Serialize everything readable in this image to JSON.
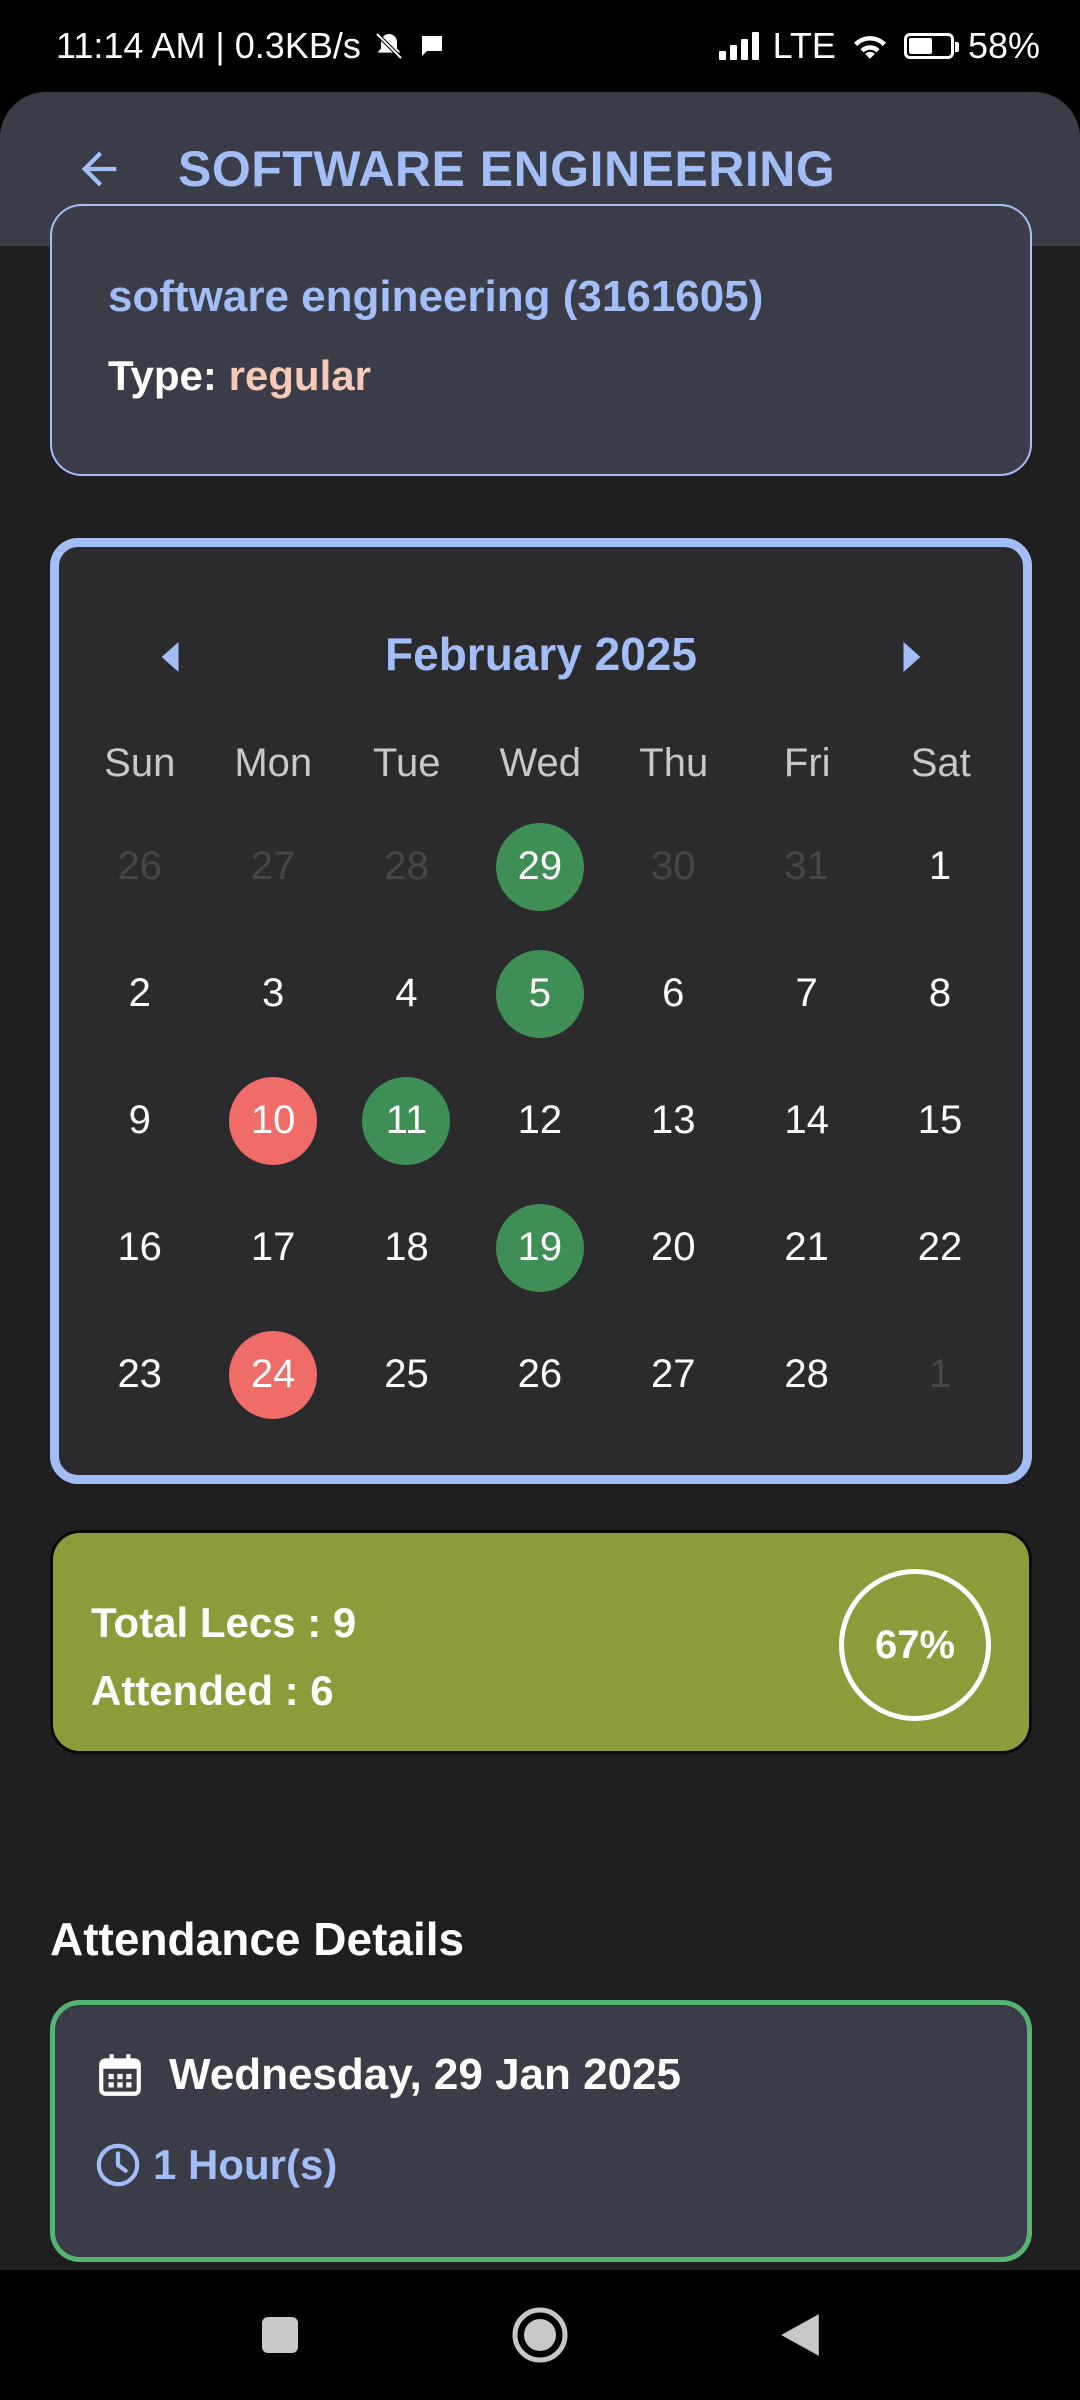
{
  "status_bar": {
    "left_text": "11:14 AM | 0.3KB/s",
    "network": "LTE",
    "battery": "58%",
    "battery_level": 0.58
  },
  "app_bar": {
    "title": "SOFTWARE ENGINEERING"
  },
  "course": {
    "name": "software engineering (3161605)",
    "type_label": "Type:",
    "type_value": "regular"
  },
  "calendar": {
    "month": "February 2025",
    "weekdays": [
      "Sun",
      "Mon",
      "Tue",
      "Wed",
      "Thu",
      "Fri",
      "Sat"
    ],
    "days": [
      {
        "d": "26",
        "state": "muted"
      },
      {
        "d": "27",
        "state": "muted"
      },
      {
        "d": "28",
        "state": "muted"
      },
      {
        "d": "29",
        "state": "present"
      },
      {
        "d": "30",
        "state": "muted"
      },
      {
        "d": "31",
        "state": "muted"
      },
      {
        "d": "1",
        "state": "normal"
      },
      {
        "d": "2",
        "state": "normal"
      },
      {
        "d": "3",
        "state": "normal"
      },
      {
        "d": "4",
        "state": "normal"
      },
      {
        "d": "5",
        "state": "present"
      },
      {
        "d": "6",
        "state": "normal"
      },
      {
        "d": "7",
        "state": "normal"
      },
      {
        "d": "8",
        "state": "normal"
      },
      {
        "d": "9",
        "state": "normal"
      },
      {
        "d": "10",
        "state": "absent"
      },
      {
        "d": "11",
        "state": "present"
      },
      {
        "d": "12",
        "state": "normal"
      },
      {
        "d": "13",
        "state": "normal"
      },
      {
        "d": "14",
        "state": "normal"
      },
      {
        "d": "15",
        "state": "normal"
      },
      {
        "d": "16",
        "state": "normal"
      },
      {
        "d": "17",
        "state": "normal"
      },
      {
        "d": "18",
        "state": "normal"
      },
      {
        "d": "19",
        "state": "present"
      },
      {
        "d": "20",
        "state": "normal"
      },
      {
        "d": "21",
        "state": "normal"
      },
      {
        "d": "22",
        "state": "normal"
      },
      {
        "d": "23",
        "state": "normal"
      },
      {
        "d": "24",
        "state": "absent"
      },
      {
        "d": "25",
        "state": "normal"
      },
      {
        "d": "26",
        "state": "normal"
      },
      {
        "d": "27",
        "state": "normal"
      },
      {
        "d": "28",
        "state": "normal"
      },
      {
        "d": "1",
        "state": "muted"
      }
    ]
  },
  "stats": {
    "total": "Total Lecs : 9",
    "attended": "Attended : 6",
    "percent": "67%"
  },
  "details": {
    "section_title": "Attendance Details",
    "items": [
      {
        "date": "Wednesday, 29 Jan 2025",
        "duration": "1 Hour(s)"
      }
    ]
  },
  "colors": {
    "accent": "#a3bdf7",
    "present": "#3e8e56",
    "absent": "#f06c69",
    "stats_bg": "#8b9c3a",
    "card_bg": "#3a3d47"
  },
  "icons": {
    "back": "arrow-left-icon",
    "calendar": "calendar-icon",
    "clock": "clock-icon"
  }
}
